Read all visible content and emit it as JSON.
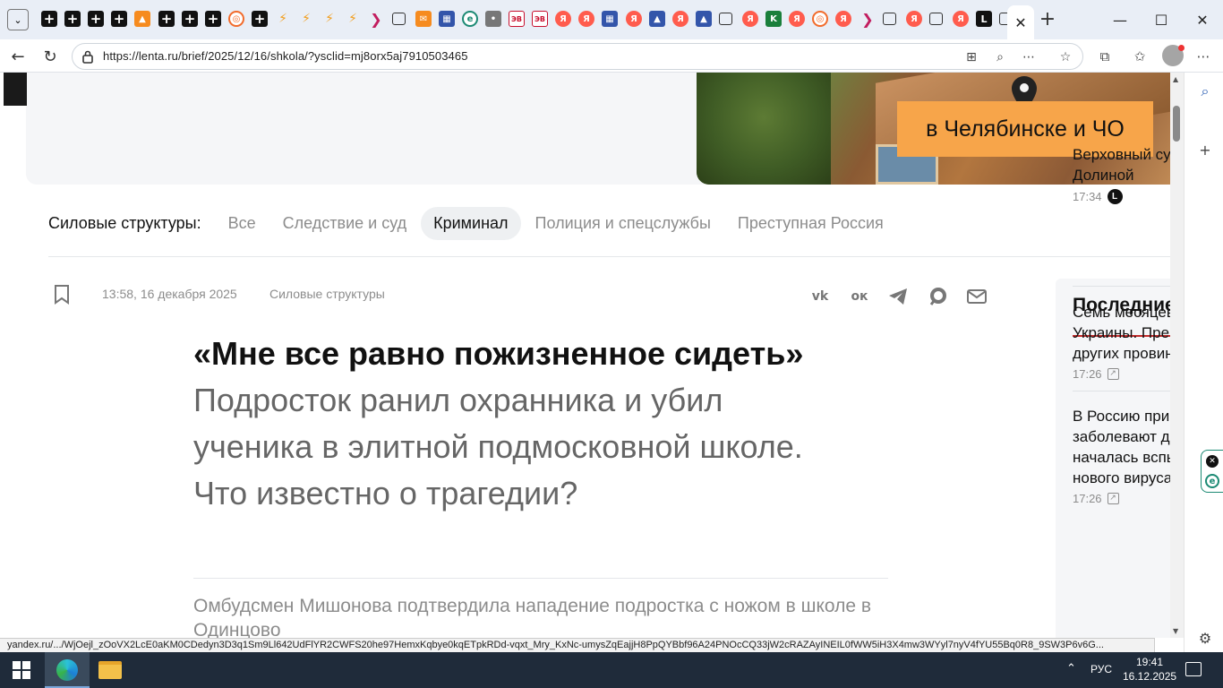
{
  "browser": {
    "url": "https://lenta.ru/brief/2025/12/16/shkola/?ysclid=mj8orx5aj7910503465",
    "tab_favicons": [
      "plus-icon",
      "plus-icon",
      "plus-icon",
      "plus-icon",
      "pizza-icon",
      "plus-icon",
      "plus-icon",
      "plus-icon",
      "ring-icon",
      "plus-icon",
      "bolt-icon",
      "bolt-icon",
      "bolt-icon",
      "bolt-icon",
      "chevron-icon",
      "box-icon",
      "mail-icon",
      "news-icon",
      "e-icon",
      "person-icon",
      "ev-icon",
      "ev-icon",
      "ya-icon",
      "ya-icon",
      "news-icon",
      "ya-icon",
      "triangle-icon",
      "ya-icon",
      "triangle-icon",
      "box-icon",
      "ya-icon",
      "k-icon",
      "ya-icon",
      "ring-icon",
      "ya-icon",
      "chevron-icon",
      "box-icon",
      "ya-icon",
      "box-icon",
      "ya-icon",
      "l-icon",
      "box-icon"
    ],
    "ev_label": "ЭВ",
    "ya_label": "Я",
    "l_label": "L",
    "k_label": "K"
  },
  "ad": {
    "badge_text": "в Челябинске и ЧО"
  },
  "rubric_nav": {
    "title": "Силовые структуры:",
    "items": [
      {
        "label": "Все",
        "active": false
      },
      {
        "label": "Следствие и суд",
        "active": false
      },
      {
        "label": "Криминал",
        "active": true
      },
      {
        "label": "Полиция и спецслужбы",
        "active": false
      },
      {
        "label": "Преступная Россия",
        "active": false
      }
    ]
  },
  "article": {
    "date": "13:58, 16 декабря 2025",
    "rubric": "Силовые структуры",
    "headline_bold": "«Мне все равно пожизненное сидеть»",
    "headline_rest": " Подросток ранил охранника и убил ученика в элитной подмосковной школе. Что известно о трагедии?",
    "lead": "Омбудсмен Мишонова подтвердила нападение подростка с ножом в школе в Одинцово"
  },
  "share": {
    "vk": "vk",
    "ok": "ок"
  },
  "sidebar": {
    "title": "Последние новости",
    "items": [
      {
        "title": "Верховный суд Долиной",
        "lines": [
          "Верховный суд",
          "Долиной"
        ],
        "time": "17:34",
        "badge": "L"
      },
      {
        "title": "Семь месяцев Украины. Пре других провинций",
        "lines": [
          "Семь месяцев",
          "Украины. Пре",
          "других провин"
        ],
        "time": "17:26",
        "badge": "ext"
      },
      {
        "title": "В Россию при заболевают д началась вспышка нового вируса",
        "lines": [
          "В Россию при",
          "заболевают д",
          "началась вспы",
          "нового вируса"
        ],
        "time": "17:26",
        "badge": "ext"
      }
    ]
  },
  "status_bar": {
    "link": "yandex.ru/.../WjOejl_zOoVX2LcE0aKM0CDedyn3D3q1Sm9Ll642UdFlYR2CWFS20he97HemxKqbye0kqETpkRDd-vqxt_Mry_KxNc-umysZqEajjH8PpQYBbf96A24PNOcCQ33jW2cRAZAyINEIL0fWW5iH3X4mw3WYyl7nyV4fYU55Bq0R8_9SW3P6v6G..."
  },
  "taskbar": {
    "lang": "РУС",
    "time": "19:41",
    "date": "16.12.2025"
  }
}
